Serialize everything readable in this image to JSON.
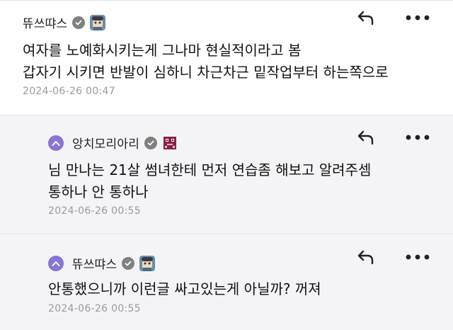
{
  "comments": [
    {
      "username": "뜌쓰땨스",
      "lines": [
        "여자를 노예화시키는게 그나마 현실적이라고 봄",
        "갑자기 시키면 반발이 심하니 차근차근 밑작업부터 하는쪽으로"
      ],
      "timestamp": "2024-06-26 00:47",
      "is_reply": false,
      "verified_icon": "check-circle-icon",
      "avatar_icon": "avatar-anime-icon"
    },
    {
      "username": "앙치모리아리",
      "lines": [
        "님 만나는 21살 썸녀한테 먼저 연습좀 해보고 알려주셈",
        "통하나 안 통하나"
      ],
      "timestamp": "2024-06-26 00:55",
      "is_reply": true,
      "verified_icon": "check-circle-icon",
      "avatar_icon": "avatar-pixel-icon"
    },
    {
      "username": "뜌쓰땨스",
      "lines": [
        "안통했으니까 이런글 싸고있는게 아닐까? 꺼져"
      ],
      "timestamp": "2024-06-26 00:55",
      "is_reply": true,
      "verified_icon": "check-circle-icon",
      "avatar_icon": "avatar-anime-icon"
    }
  ],
  "icons": {
    "reply": "reply-arrow-icon",
    "more": "more-dots-icon",
    "reply_marker": "reply-indicator-icon"
  },
  "colors": {
    "accent": "#8a74d6",
    "reply_bg": "#f4f4f6",
    "timestamp": "#9a9a9a"
  }
}
